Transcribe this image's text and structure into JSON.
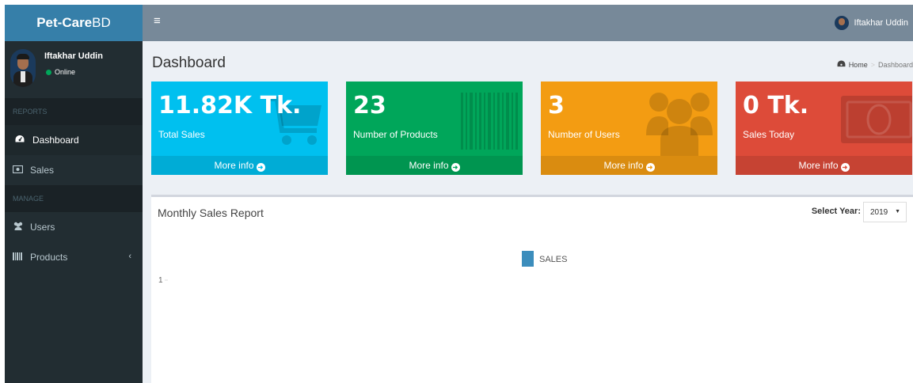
{
  "sidebar": {
    "logo_bold": "Pet-Care",
    "logo_rest": "BD",
    "user": {
      "name": "Iftakhar Uddin",
      "status": "Online"
    },
    "sections": [
      {
        "header": "REPORTS",
        "items": [
          {
            "label": "Dashboard",
            "icon": "dashboard-icon",
            "active": true
          },
          {
            "label": "Sales",
            "icon": "money-icon"
          }
        ]
      },
      {
        "header": "MANAGE",
        "items": [
          {
            "label": "Users",
            "icon": "users-icon"
          },
          {
            "label": "Products",
            "icon": "barcode-icon"
          }
        ]
      }
    ]
  },
  "topbar": {
    "toggle_icon": "bars-icon",
    "user_name": "Iftakhar Uddin"
  },
  "content": {
    "title": "Dashboard",
    "breadcrumb": {
      "home": "Home",
      "current": "Dashboard"
    }
  },
  "boxes": [
    {
      "value": "11.82K Tk.",
      "label": "Total Sales",
      "link": "More info",
      "color": "#00c0ef",
      "icon": "shopping-cart-icon"
    },
    {
      "value": "23",
      "label": "Number of Products",
      "link": "More info",
      "color": "#00a65a",
      "icon": "barcode-icon"
    },
    {
      "value": "3",
      "label": "Number of Users",
      "link": "More info",
      "color": "#f39c12",
      "icon": "users-icon"
    },
    {
      "value": "0 Tk.",
      "label": "Sales Today",
      "link": "More info",
      "color": "#dd4b39",
      "icon": "money-icon"
    }
  ],
  "report": {
    "title": "Monthly Sales Report",
    "year_label": "Select Year:",
    "year_value": "2019"
  },
  "chart_data": {
    "type": "bar",
    "categories": [],
    "series": [
      {
        "name": "SALES",
        "values": [],
        "color": "#3c8dbc"
      }
    ],
    "y_ticks": [
      "1"
    ],
    "legend": "top-center"
  }
}
